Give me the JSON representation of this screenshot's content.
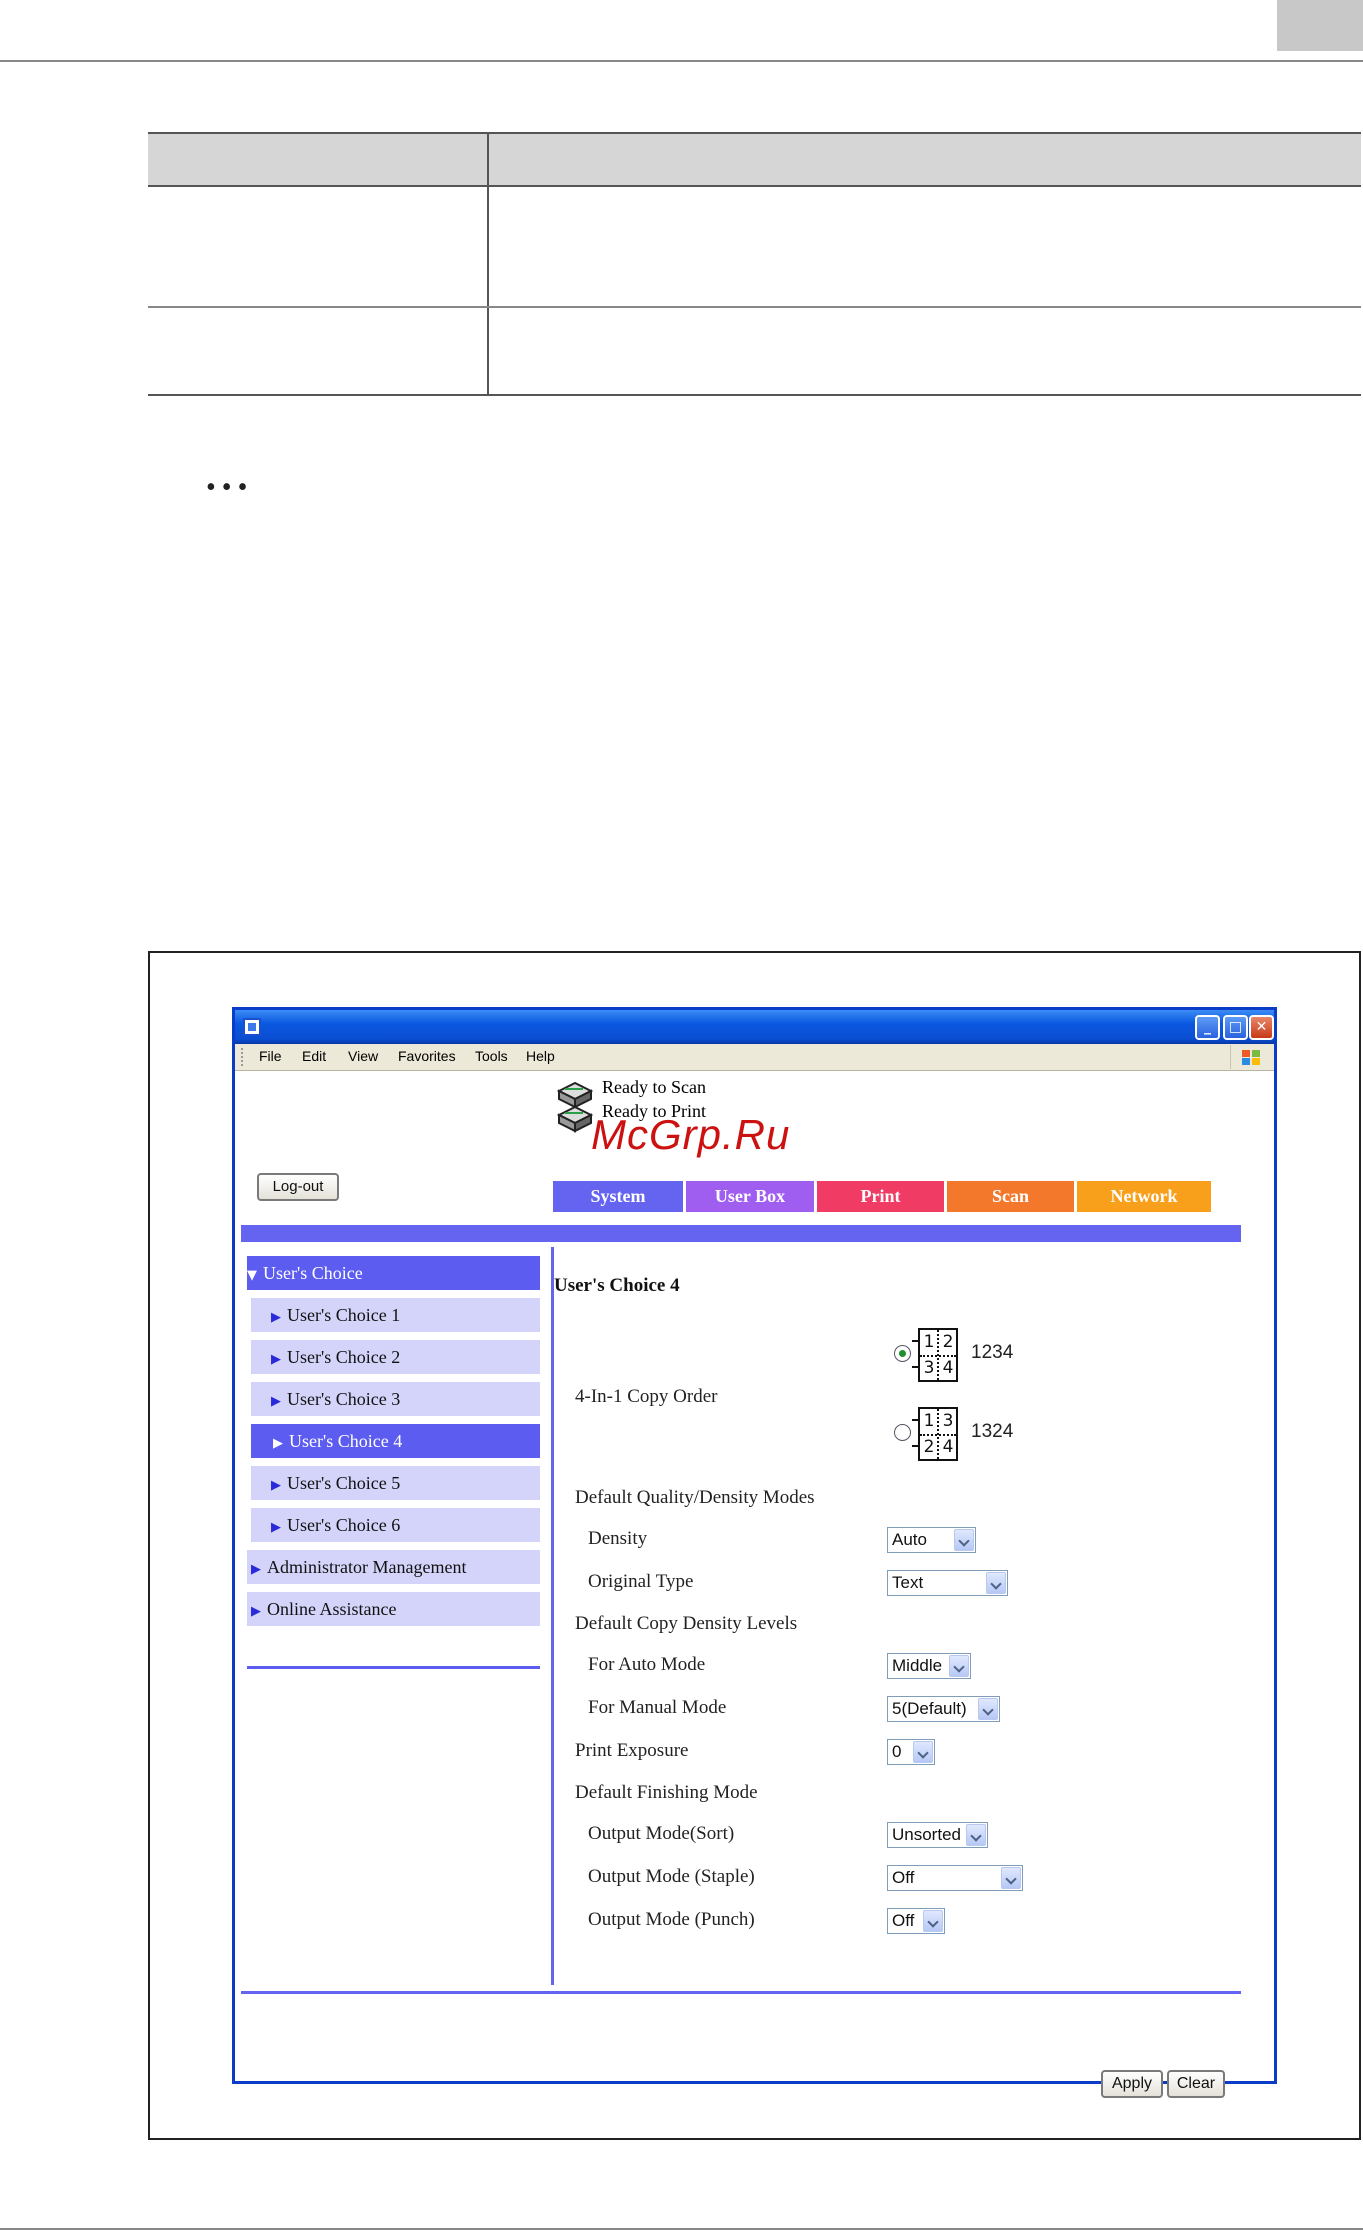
{
  "window": {
    "menu": [
      "File",
      "Edit",
      "View",
      "Favorites",
      "Tools",
      "Help"
    ],
    "buttons": {
      "minimize": "_",
      "maximize": "□",
      "close": "✕"
    }
  },
  "header": {
    "status_scan": "Ready to Scan",
    "status_print": "Ready to Print",
    "watermark": "McGrp.Ru",
    "logout_label": "Log-out"
  },
  "tabs": [
    {
      "label": "System",
      "color": "#6464f0"
    },
    {
      "label": "User Box",
      "color": "#a05ef0"
    },
    {
      "label": "Print",
      "color": "#f03c64"
    },
    {
      "label": "Scan",
      "color": "#f4782c"
    },
    {
      "label": "Network",
      "color": "#f8a01c"
    }
  ],
  "sidebar": {
    "section": "User's Choice",
    "items": [
      "User's Choice 1",
      "User's Choice 2",
      "User's Choice 3",
      "User's Choice 4",
      "User's Choice 5",
      "User's Choice 6"
    ],
    "active_index": 3,
    "admin": "Administrator Management",
    "online": "Online Assistance"
  },
  "form": {
    "title": "User's Choice 4",
    "copy_order": {
      "label": "4-In-1 Copy Order",
      "options": [
        {
          "value": "1234",
          "cells": [
            "1",
            "2",
            "3",
            "4"
          ],
          "selected": true
        },
        {
          "value": "1324",
          "cells": [
            "1",
            "3",
            "2",
            "4"
          ],
          "selected": false
        }
      ]
    },
    "quality_heading": "Default Quality/Density Modes",
    "density": {
      "label": "Density",
      "value": "Auto"
    },
    "original_type": {
      "label": "Original Type",
      "value": "Text"
    },
    "copy_density_heading": "Default Copy Density Levels",
    "auto_mode": {
      "label": "For Auto Mode",
      "value": "Middle"
    },
    "manual_mode": {
      "label": "For Manual Mode",
      "value": "5(Default)"
    },
    "print_exposure": {
      "label": "Print Exposure",
      "value": "0"
    },
    "finishing_heading": "Default Finishing Mode",
    "output_sort": {
      "label": "Output Mode(Sort)",
      "value": "Unsorted"
    },
    "output_staple": {
      "label": "Output Mode (Staple)",
      "value": "Off"
    },
    "output_punch": {
      "label": "Output Mode (Punch)",
      "value": "Off"
    }
  },
  "actions": {
    "apply": "Apply",
    "clear": "Clear"
  },
  "doc": {
    "ellipsis": "•••"
  }
}
